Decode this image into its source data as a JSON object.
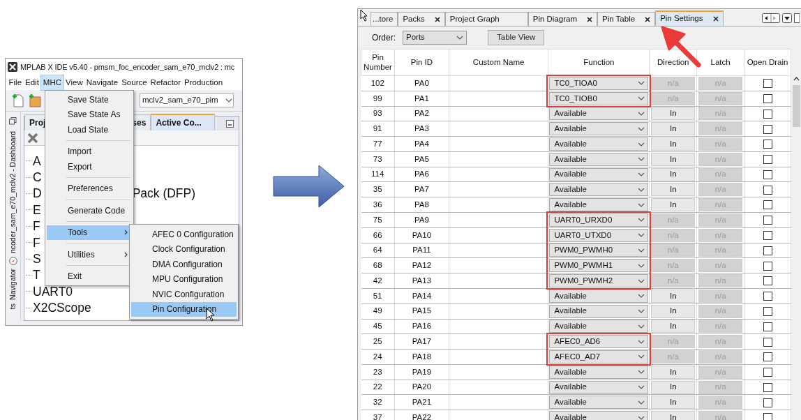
{
  "ide_window": {
    "title": "MPLAB X IDE v5.40 - pmsm_foc_encoder_sam_e70_mclv2 : mc",
    "menubar": [
      {
        "label": "File",
        "selected": false
      },
      {
        "label": "Edit",
        "selected": false
      },
      {
        "label": "MHC",
        "selected": true
      },
      {
        "label": "View",
        "selected": false
      },
      {
        "label": "Navigate",
        "selected": false
      },
      {
        "label": "Source",
        "selected": false
      },
      {
        "label": "Refactor",
        "selected": false
      },
      {
        "label": "Production",
        "selected": false
      }
    ],
    "config_combo": "mclv2_sam_e70_pim",
    "side_tabs": [
      "ncoder_sam_e70_mclv2 - Dashboard",
      "Navigator",
      "ts"
    ],
    "panel_tabs": [
      {
        "label": "Proj",
        "selected": false
      },
      {
        "label": "ses",
        "selected": false
      },
      {
        "label": "Active Co...",
        "selected": true
      }
    ],
    "tree": [
      {
        "text": "A"
      },
      {
        "text": "C"
      },
      {
        "text": "D",
        "text_right": "Pack (DFP)"
      },
      {
        "text": "E"
      },
      {
        "text": "F"
      },
      {
        "text": "F"
      },
      {
        "text": "S"
      },
      {
        "text": "T"
      },
      {
        "text": "UART0"
      },
      {
        "text": "X2CScope"
      }
    ],
    "menu": [
      {
        "kind": "item",
        "label": "Save State",
        "selected": false
      },
      {
        "kind": "item",
        "label": "Save State As",
        "selected": false
      },
      {
        "kind": "item",
        "label": "Load State",
        "selected": false
      },
      {
        "kind": "separator"
      },
      {
        "kind": "item",
        "label": "Import",
        "selected": false
      },
      {
        "kind": "item",
        "label": "Export",
        "selected": false
      },
      {
        "kind": "separator"
      },
      {
        "kind": "item",
        "label": "Preferences",
        "selected": false
      },
      {
        "kind": "separator"
      },
      {
        "kind": "item",
        "label": "Generate Code",
        "selected": false
      },
      {
        "kind": "separator"
      },
      {
        "kind": "submenu",
        "label": "Tools",
        "selected": true
      },
      {
        "kind": "separator"
      },
      {
        "kind": "submenu",
        "label": "Utilities",
        "selected": false
      },
      {
        "kind": "separator"
      },
      {
        "kind": "item",
        "label": "Exit",
        "selected": false
      }
    ],
    "submenu": [
      {
        "label": "AFEC 0 Configuration",
        "selected": false
      },
      {
        "label": "Clock Configuration",
        "selected": false
      },
      {
        "label": "DMA Configuration",
        "selected": false
      },
      {
        "label": "MPU Configuration",
        "selected": false
      },
      {
        "label": "NVIC Configuration",
        "selected": false
      },
      {
        "label": "Pin Configuration",
        "selected": true
      }
    ]
  },
  "pin_window": {
    "tabs": [
      {
        "label": "...tore",
        "closable": false,
        "selected": false
      },
      {
        "label": "Packs",
        "closable": true,
        "selected": false
      },
      {
        "label": "Project Graph",
        "closable": false,
        "selected": false
      },
      {
        "label": "Pin Diagram",
        "closable": true,
        "selected": false
      },
      {
        "label": "Pin Table",
        "closable": true,
        "selected": false
      },
      {
        "label": "Pin Settings",
        "closable": true,
        "selected": true
      }
    ],
    "order_label": "Order:",
    "order_select": "Ports",
    "table_view_button": "Table View",
    "columns": [
      "Pin Number",
      "Pin ID",
      "Custom Name",
      "Function",
      "Direction",
      "Latch",
      "Open Drain"
    ],
    "rows": [
      {
        "pin": "102",
        "id": "PA0",
        "function": "TC0_TIOA0",
        "direction": "n/a",
        "direction_disabled": true,
        "latch": "n/a",
        "open_drain": false,
        "highlighted": true
      },
      {
        "pin": "99",
        "id": "PA1",
        "function": "TC0_TIOB0",
        "direction": "n/a",
        "direction_disabled": true,
        "latch": "n/a",
        "open_drain": false,
        "highlighted": true
      },
      {
        "pin": "93",
        "id": "PA2",
        "function": "Available",
        "direction": "In",
        "direction_disabled": false,
        "latch": "n/a",
        "open_drain": false,
        "highlighted": false
      },
      {
        "pin": "91",
        "id": "PA3",
        "function": "Available",
        "direction": "In",
        "direction_disabled": false,
        "latch": "n/a",
        "open_drain": false,
        "highlighted": false
      },
      {
        "pin": "77",
        "id": "PA4",
        "function": "Available",
        "direction": "In",
        "direction_disabled": false,
        "latch": "n/a",
        "open_drain": false,
        "highlighted": false
      },
      {
        "pin": "73",
        "id": "PA5",
        "function": "Available",
        "direction": "In",
        "direction_disabled": false,
        "latch": "n/a",
        "open_drain": false,
        "highlighted": false
      },
      {
        "pin": "114",
        "id": "PA6",
        "function": "Available",
        "direction": "In",
        "direction_disabled": false,
        "latch": "n/a",
        "open_drain": false,
        "highlighted": false
      },
      {
        "pin": "35",
        "id": "PA7",
        "function": "Available",
        "direction": "In",
        "direction_disabled": false,
        "latch": "n/a",
        "open_drain": false,
        "highlighted": false
      },
      {
        "pin": "36",
        "id": "PA8",
        "function": "Available",
        "direction": "In",
        "direction_disabled": false,
        "latch": "n/a",
        "open_drain": false,
        "highlighted": false
      },
      {
        "pin": "75",
        "id": "PA9",
        "function": "UART0_URXD0",
        "direction": "n/a",
        "direction_disabled": true,
        "latch": "n/a",
        "open_drain": false,
        "highlighted": true
      },
      {
        "pin": "66",
        "id": "PA10",
        "function": "UART0_UTXD0",
        "direction": "n/a",
        "direction_disabled": true,
        "latch": "n/a",
        "open_drain": false,
        "highlighted": true
      },
      {
        "pin": "64",
        "id": "PA11",
        "function": "PWM0_PWMH0",
        "direction": "n/a",
        "direction_disabled": true,
        "latch": "n/a",
        "open_drain": false,
        "highlighted": true
      },
      {
        "pin": "68",
        "id": "PA12",
        "function": "PWM0_PWMH1",
        "direction": "n/a",
        "direction_disabled": true,
        "latch": "n/a",
        "open_drain": false,
        "highlighted": true
      },
      {
        "pin": "42",
        "id": "PA13",
        "function": "PWM0_PWMH2",
        "direction": "n/a",
        "direction_disabled": true,
        "latch": "n/a",
        "open_drain": false,
        "highlighted": true
      },
      {
        "pin": "51",
        "id": "PA14",
        "function": "Available",
        "direction": "In",
        "direction_disabled": false,
        "latch": "n/a",
        "open_drain": false,
        "highlighted": false
      },
      {
        "pin": "49",
        "id": "PA15",
        "function": "Available",
        "direction": "In",
        "direction_disabled": false,
        "latch": "n/a",
        "open_drain": false,
        "highlighted": false
      },
      {
        "pin": "45",
        "id": "PA16",
        "function": "Available",
        "direction": "In",
        "direction_disabled": false,
        "latch": "n/a",
        "open_drain": false,
        "highlighted": false
      },
      {
        "pin": "25",
        "id": "PA17",
        "function": "AFEC0_AD6",
        "direction": "n/a",
        "direction_disabled": true,
        "latch": "n/a",
        "open_drain": false,
        "highlighted": true
      },
      {
        "pin": "24",
        "id": "PA18",
        "function": "AFEC0_AD7",
        "direction": "n/a",
        "direction_disabled": true,
        "latch": "n/a",
        "open_drain": false,
        "highlighted": true
      },
      {
        "pin": "23",
        "id": "PA19",
        "function": "Available",
        "direction": "In",
        "direction_disabled": false,
        "latch": "n/a",
        "open_drain": false,
        "highlighted": false
      },
      {
        "pin": "22",
        "id": "PA20",
        "function": "Available",
        "direction": "In",
        "direction_disabled": false,
        "latch": "n/a",
        "open_drain": false,
        "highlighted": false
      },
      {
        "pin": "32",
        "id": "PA21",
        "function": "Available",
        "direction": "In",
        "direction_disabled": false,
        "latch": "n/a",
        "open_drain": false,
        "highlighted": false
      },
      {
        "pin": "37",
        "id": "PA22",
        "function": "Available",
        "direction": "In",
        "direction_disabled": false,
        "latch": "n/a",
        "open_drain": false,
        "highlighted": false
      }
    ]
  }
}
